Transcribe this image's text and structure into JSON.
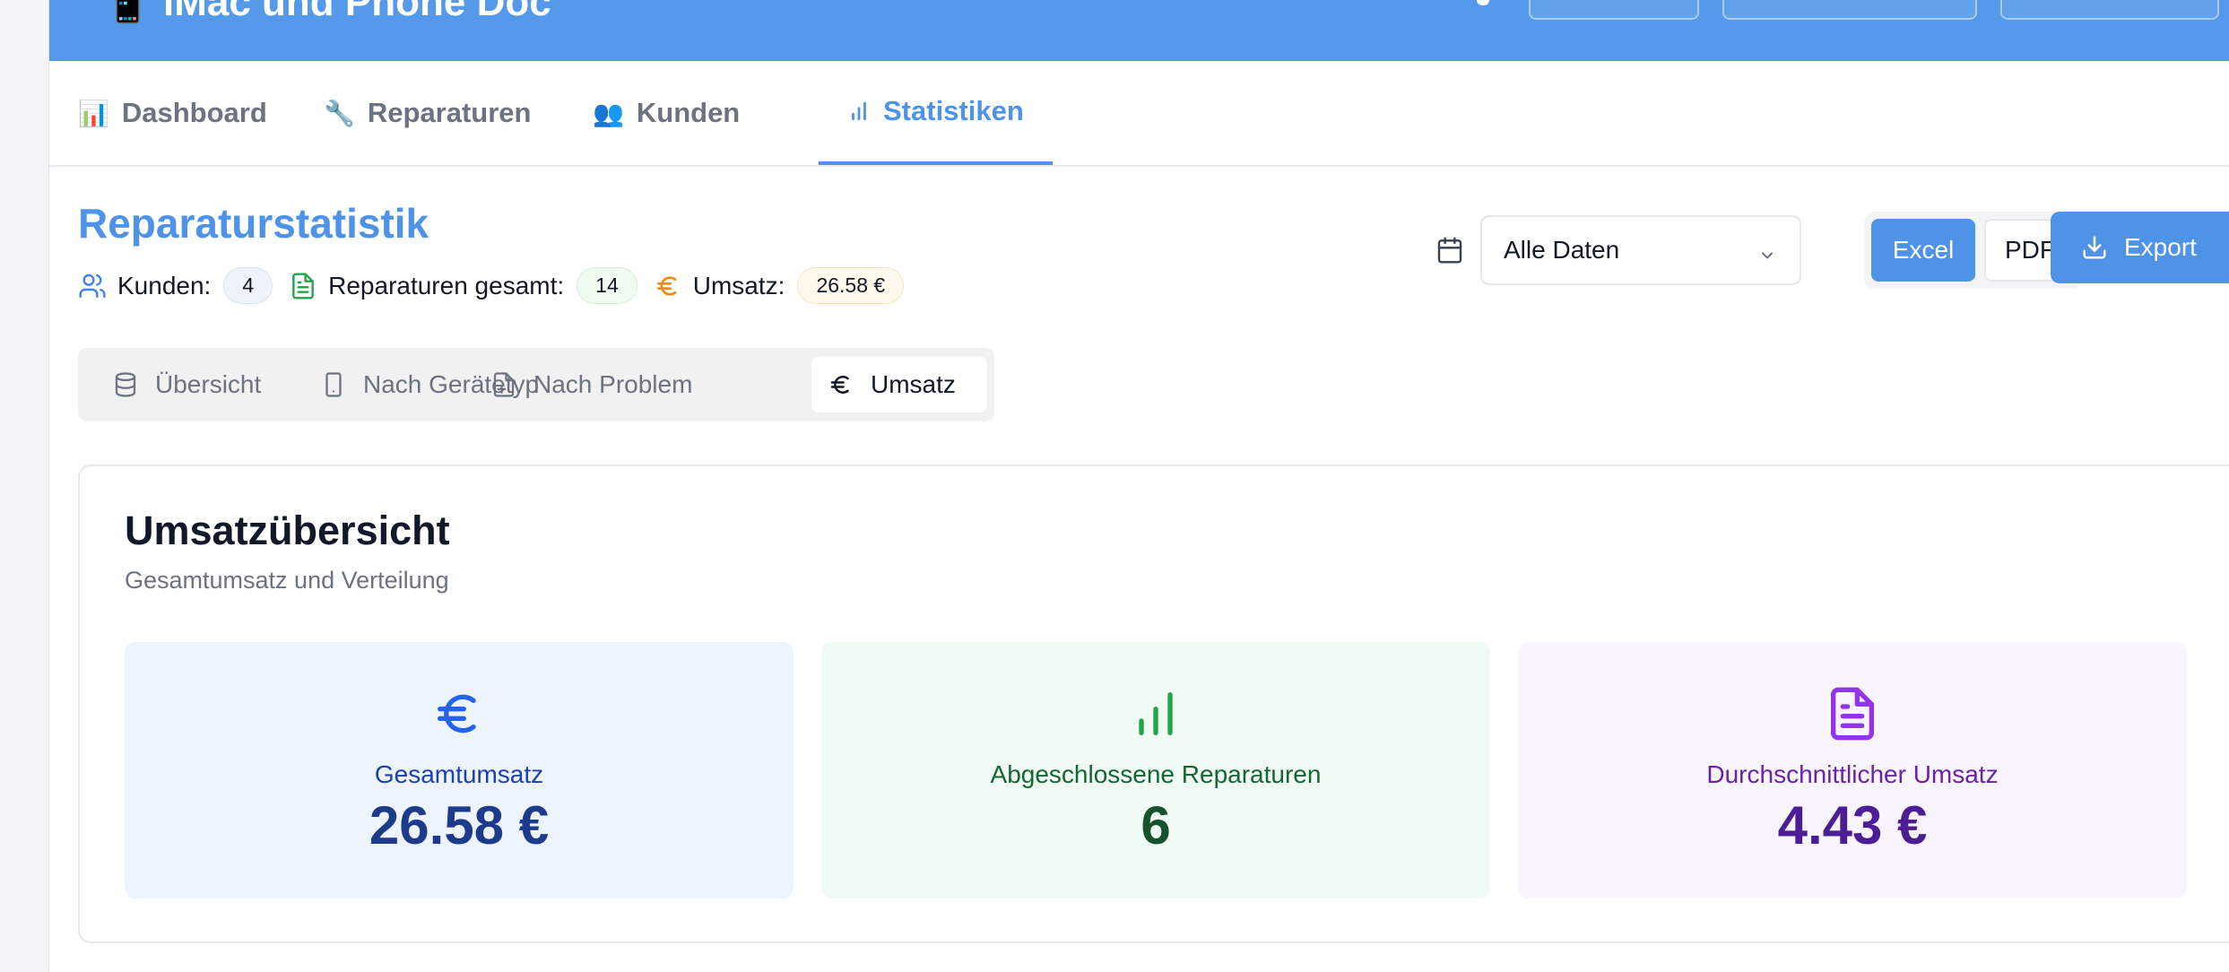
{
  "header": {
    "title": "📱 iMac und Phone Doc"
  },
  "nav": {
    "tabs": [
      {
        "icon": "📊",
        "label": "Dashboard"
      },
      {
        "icon": "🔧",
        "label": "Reparaturen"
      },
      {
        "icon": "👥",
        "label": "Kunden"
      },
      {
        "icon": "bar-chart-icon",
        "label": "Statistiken",
        "active": true
      }
    ]
  },
  "page": {
    "title": "Reparaturstatistik",
    "stats": {
      "customers_label": "Kunden:",
      "customers_value": "4",
      "repairs_label": "Reparaturen gesamt:",
      "repairs_value": "14",
      "revenue_label": "Umsatz:",
      "revenue_value": "26.58 €"
    }
  },
  "controls": {
    "date_filter": "Alle Daten",
    "format_excel": "Excel",
    "format_pdf": "PDF",
    "export_label": "Export"
  },
  "subtabs": [
    {
      "icon": "database-icon",
      "label": "Übersicht"
    },
    {
      "icon": "smartphone-icon",
      "label": "Nach Gerätetyp"
    },
    {
      "icon": "file-plus-icon",
      "label": "Nach Problem"
    },
    {
      "icon": "euro-icon",
      "label": "Umsatz",
      "active": true
    }
  ],
  "card": {
    "title": "Umsatzübersicht",
    "subtitle": "Gesamtumsatz und Verteilung",
    "metrics": [
      {
        "icon": "euro-icon",
        "label": "Gesamtumsatz",
        "value": "26.58 €"
      },
      {
        "icon": "bar-chart-icon",
        "label": "Abgeschlossene Reparaturen",
        "value": "6"
      },
      {
        "icon": "file-text-icon",
        "label": "Durchschnittlicher Umsatz",
        "value": "4.43 €"
      }
    ]
  },
  "colors": {
    "accent": "#4f93e8",
    "header_bg": "#5599ea"
  }
}
